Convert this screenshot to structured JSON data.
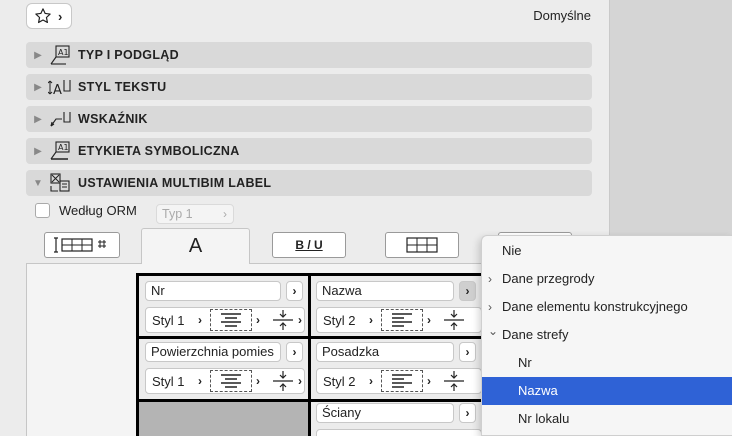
{
  "header": {
    "top_right_label": "Domyślne",
    "favorites_icon": "star-icon"
  },
  "sections": [
    {
      "title": "TYP I PODGLĄD",
      "expanded": false,
      "icon": "type-preview-icon"
    },
    {
      "title": "STYL TEKSTU",
      "expanded": false,
      "icon": "text-style-icon"
    },
    {
      "title": "WSKAŹNIK",
      "expanded": false,
      "icon": "pointer-icon"
    },
    {
      "title": "ETYKIETA SYMBOLICZNA",
      "expanded": false,
      "icon": "symbol-label-icon"
    },
    {
      "title": "USTAWIENIA MULTIBIM LABEL",
      "expanded": true,
      "icon": "multibim-label-icon"
    }
  ],
  "orm": {
    "checkbox_label": "Według ORM",
    "checked": false,
    "type_select": "Typ 1"
  },
  "toolbar": {
    "active_tab_glyph": "A",
    "format_label": "B / U"
  },
  "grid": {
    "cells": [
      {
        "field": "Nr",
        "style": "Styl 1"
      },
      {
        "field": "Nazwa",
        "style": "Styl 2"
      },
      {
        "field": "Powierzchnia pomies",
        "style": "Styl 1"
      },
      {
        "field": "Posadzka",
        "style": "Styl 2"
      },
      {
        "field": "Ściany"
      }
    ]
  },
  "menu": {
    "items": [
      {
        "label": "Nie",
        "arrow": ""
      },
      {
        "label": "Dane przegrody",
        "arrow": "›"
      },
      {
        "label": "Dane elementu konstrukcyjnego",
        "arrow": "›"
      },
      {
        "label": "Dane strefy",
        "arrow": "⌄"
      },
      {
        "label": "Nr",
        "arrow": ""
      },
      {
        "label": "Nazwa",
        "arrow": "",
        "selected": true
      },
      {
        "label": "Nr lokalu",
        "arrow": ""
      }
    ]
  },
  "colors": {
    "selection": "#2f62d6",
    "panel": "#ececec",
    "section_bar": "#d9d9d9"
  }
}
